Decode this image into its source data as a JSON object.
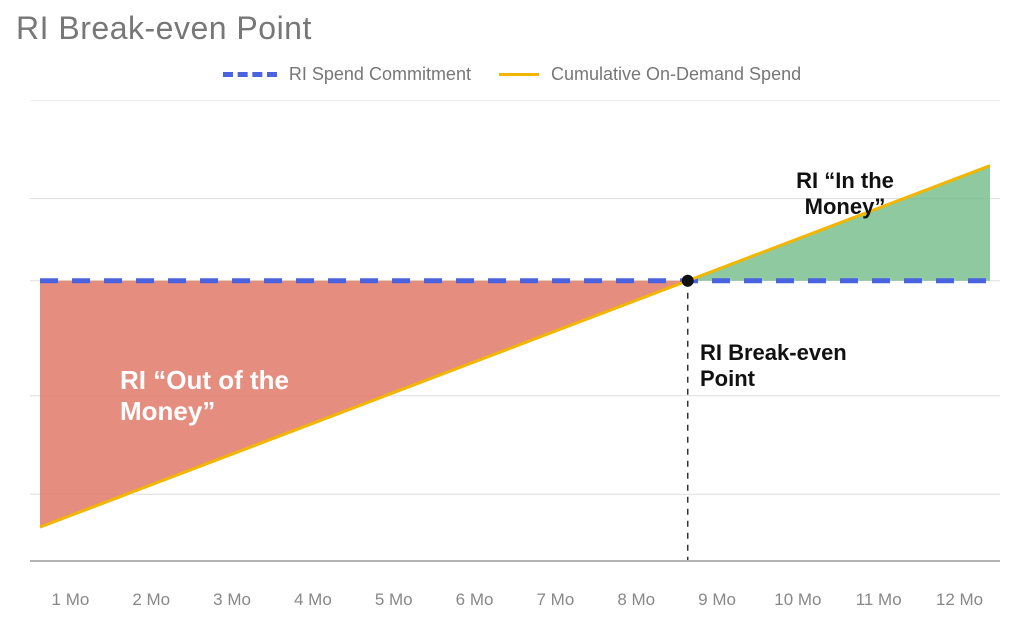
{
  "title": "RI Break-even Point",
  "legend": {
    "commit": "RI Spend Commitment",
    "ondemand": "Cumulative On-Demand Spend"
  },
  "annotations": {
    "out_of_money": "RI “Out of the Money”",
    "in_the_money": "RI “In the Money”",
    "break_even": "RI Break-even Point"
  },
  "chart_data": {
    "type": "line",
    "categories": [
      "1 Mo",
      "2 Mo",
      "3 Mo",
      "4 Mo",
      "5 Mo",
      "6 Mo",
      "7 Mo",
      "8 Mo",
      "9 Mo",
      "10 Mo",
      "11 Mo",
      "12 Mo"
    ],
    "series": [
      {
        "name": "RI Spend Commitment",
        "style": "dashed",
        "color": "#4a63e0",
        "values": [
          8.5,
          8.5,
          8.5,
          8.5,
          8.5,
          8.5,
          8.5,
          8.5,
          8.5,
          8.5,
          8.5,
          8.5
        ]
      },
      {
        "name": "Cumulative On-Demand Spend",
        "style": "solid",
        "color": "#f2b600",
        "values": [
          1.0,
          2.0,
          3.0,
          4.0,
          5.0,
          6.0,
          7.0,
          8.0,
          9.0,
          10.0,
          11.0,
          12.0
        ]
      }
    ],
    "regions": [
      {
        "name": "RI Out of the Money",
        "color": "#e07a6a",
        "x_range": [
          1,
          8.5
        ],
        "between": [
          "Cumulative On-Demand Spend",
          "RI Spend Commitment"
        ]
      },
      {
        "name": "RI In the Money",
        "color": "#7bbf8f",
        "x_range": [
          8.5,
          12
        ],
        "between": [
          "RI Spend Commitment",
          "Cumulative On-Demand Spend"
        ]
      }
    ],
    "break_even_x": 8.5,
    "xlabel": "",
    "ylabel": "",
    "ylim": [
      0,
      14
    ],
    "grid": true
  }
}
